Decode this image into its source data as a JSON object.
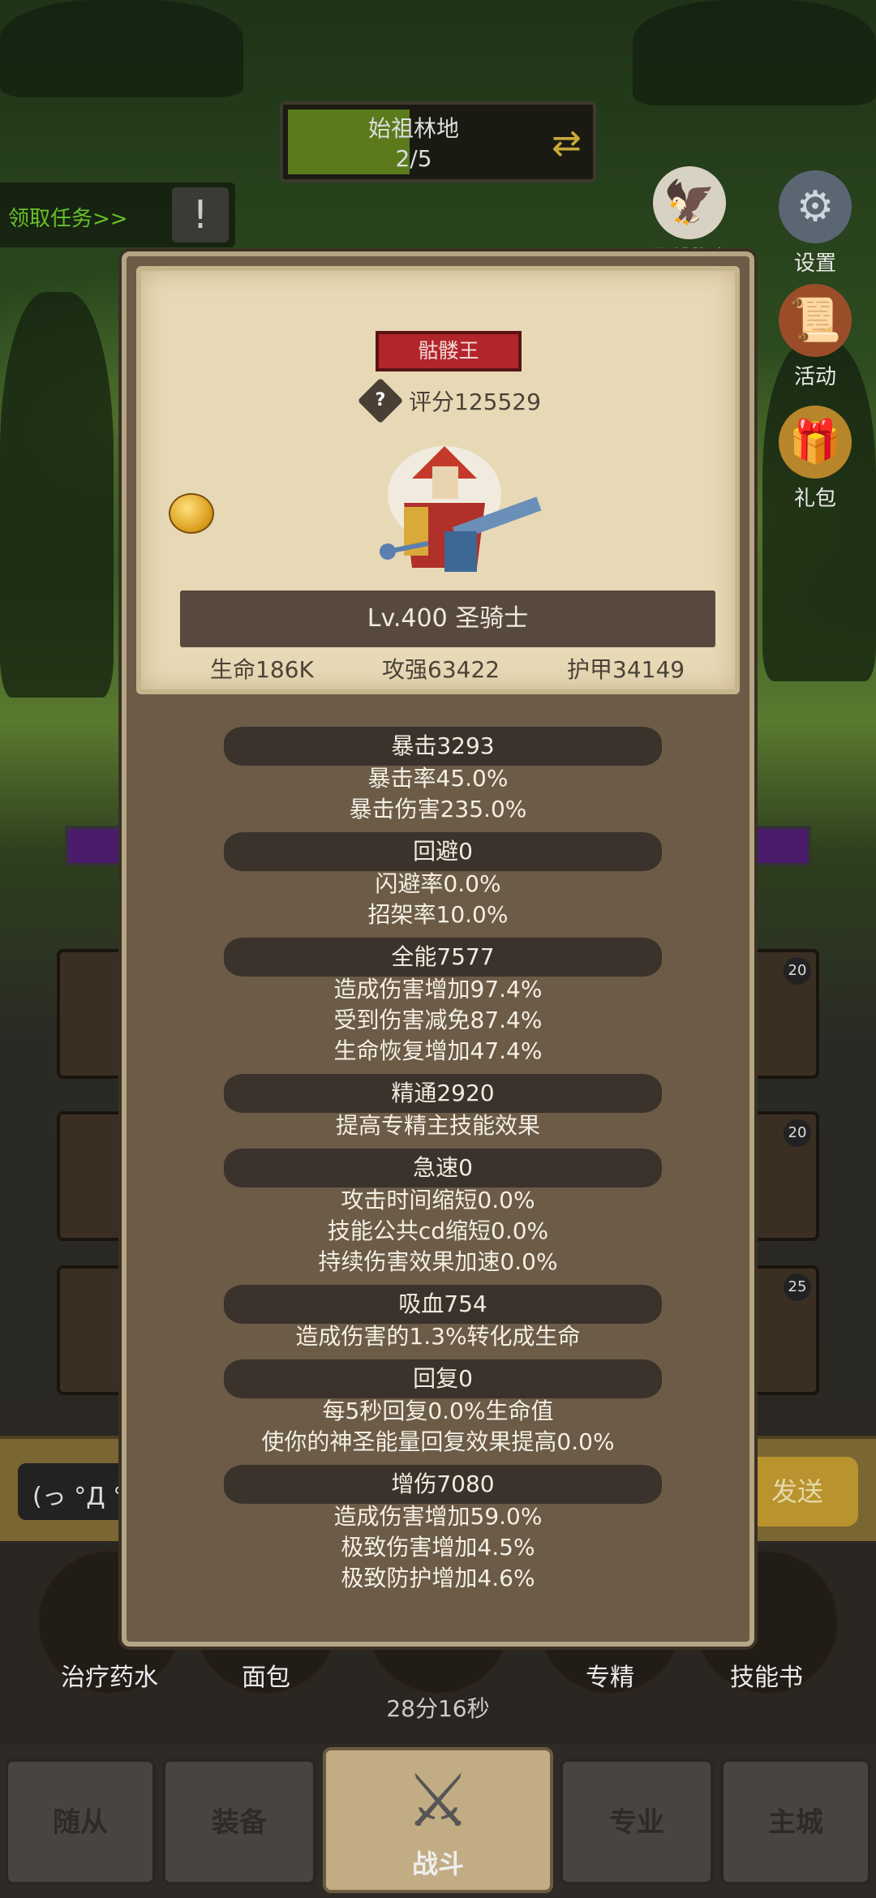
{
  "stage": {
    "name": "始祖林地",
    "progress": "2/5"
  },
  "quest": {
    "label": "领取任务>>"
  },
  "side_buttons": [
    {
      "label": "设置",
      "icon": "gear-icon"
    },
    {
      "label": "活动",
      "icon": "scroll-icon"
    },
    {
      "label": "礼包",
      "icon": "gift-icon"
    }
  ],
  "eagle_label": "狮鹫救赎",
  "panel": {
    "boss_title": "骷髅王",
    "score_label": "评分125529",
    "level_class": "Lv.400 圣骑士",
    "base_stats": [
      "生命186K",
      "攻强63422",
      "护甲34149"
    ],
    "sections": [
      {
        "header": "暴击3293",
        "lines": [
          "暴击率45.0%",
          "暴击伤害235.0%"
        ]
      },
      {
        "header": "回避0",
        "lines": [
          "闪避率0.0%",
          "招架率10.0%"
        ]
      },
      {
        "header": "全能7577",
        "lines": [
          "造成伤害增加97.4%",
          "受到伤害减免87.4%",
          "生命恢复增加47.4%"
        ]
      },
      {
        "header": "精通2920",
        "lines": [
          "提高专精主技能效果"
        ]
      },
      {
        "header": "急速0",
        "lines": [
          "攻击时间缩短0.0%",
          "技能公共cd缩短0.0%",
          "持续伤害效果加速0.0%"
        ]
      },
      {
        "header": "吸血754",
        "lines": [
          "造成伤害的1.3%转化成生命"
        ]
      },
      {
        "header": "回复0",
        "lines": [
          "每5秒回复0.0%生命值",
          "使你的神圣能量回复效果提高0.0%"
        ]
      },
      {
        "header": "增伤7080",
        "lines": [
          "造成伤害增加59.0%",
          "极致伤害增加4.5%",
          "极致防护增加4.6%"
        ]
      }
    ]
  },
  "chat": {
    "input_text": "(っ °Д °",
    "send_label": "发送"
  },
  "skill_slot_levels": [
    "20",
    "20",
    "25"
  ],
  "potions": [
    "治疗药水",
    "面包",
    "",
    "专精",
    "技能书"
  ],
  "timer": "28分16秒",
  "bottom_tabs": [
    "随从",
    "装备",
    "战斗",
    "专业",
    "主城"
  ]
}
